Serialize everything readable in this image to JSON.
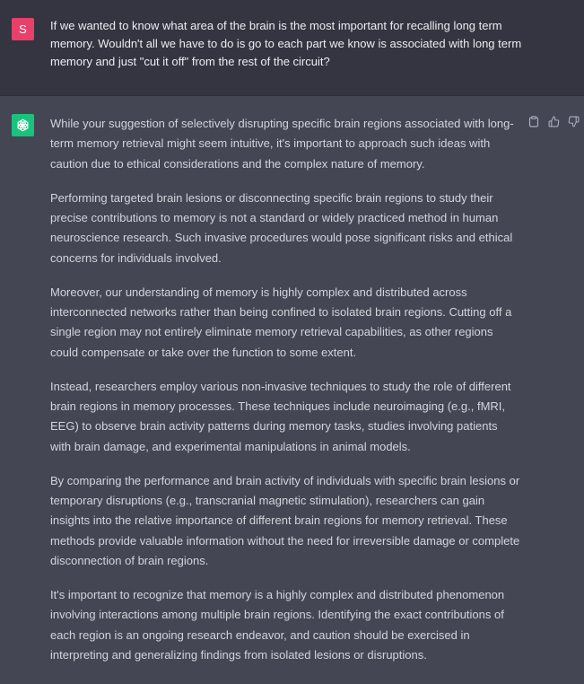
{
  "user": {
    "avatar_letter": "S",
    "avatar_color": "#e6406b",
    "message": "If we wanted to know what area of the brain is the most important for recalling long term memory. Wouldn't all we have to do is go to each part we know is associated with long term memory and just \"cut it off\" from the rest of the circuit?"
  },
  "assistant": {
    "avatar_color": "#19c37d",
    "avatar_icon": "openai-logo-icon",
    "actions": [
      "copy-icon",
      "thumbs-up-icon",
      "thumbs-down-icon"
    ],
    "paragraphs": [
      "While your suggestion of selectively disrupting specific brain regions associated with long-term memory retrieval might seem intuitive, it's important to approach such ideas with caution due to ethical considerations and the complex nature of memory.",
      "Performing targeted brain lesions or disconnecting specific brain regions to study their precise contributions to memory is not a standard or widely practiced method in human neuroscience research. Such invasive procedures would pose significant risks and ethical concerns for individuals involved.",
      "Moreover, our understanding of memory is highly complex and distributed across interconnected networks rather than being confined to isolated brain regions. Cutting off a single region may not entirely eliminate memory retrieval capabilities, as other regions could compensate or take over the function to some extent.",
      "Instead, researchers employ various non-invasive techniques to study the role of different brain regions in memory processes. These techniques include neuroimaging (e.g., fMRI, EEG) to observe brain activity patterns during memory tasks, studies involving patients with brain damage, and experimental manipulations in animal models.",
      "By comparing the performance and brain activity of individuals with specific brain lesions or temporary disruptions (e.g., transcranial magnetic stimulation), researchers can gain insights into the relative importance of different brain regions for memory retrieval. These methods provide valuable information without the need for irreversible damage or complete disconnection of brain regions.",
      "It's important to recognize that memory is a highly complex and distributed phenomenon involving interactions among multiple brain regions. Identifying the exact contributions of each region is an ongoing research endeavor, and caution should be exercised in interpreting and generalizing findings from isolated lesions or disruptions."
    ]
  }
}
